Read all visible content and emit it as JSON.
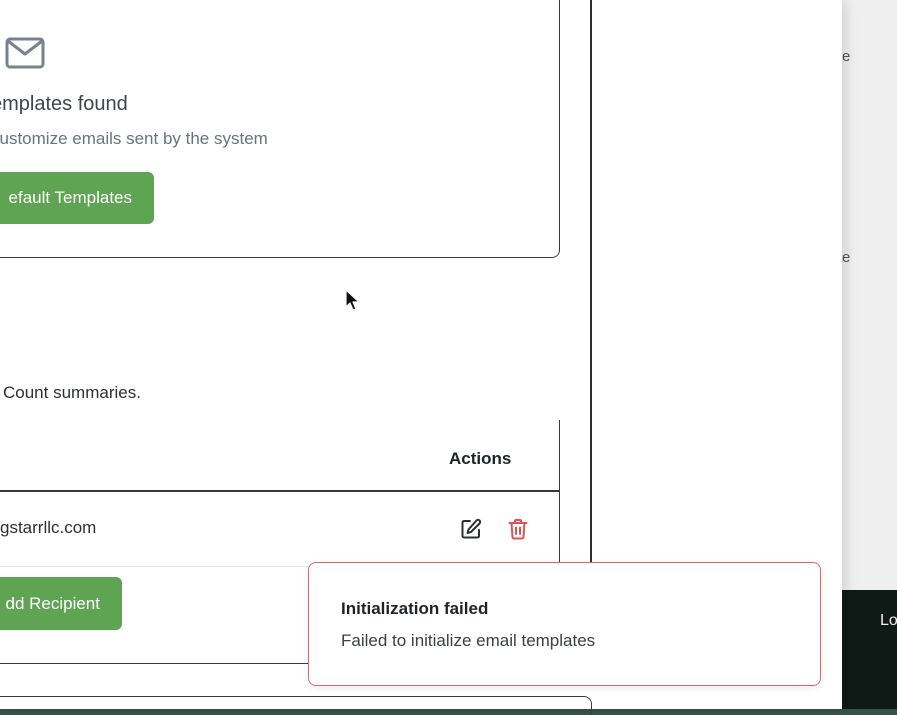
{
  "empty_state": {
    "icon": "mail-icon",
    "title": "emplates found",
    "subtitle": "customize emails sent by the system",
    "button_label": "efault Templates"
  },
  "recipients": {
    "description": "Count summaries.",
    "columns": {
      "actions": "Actions"
    },
    "rows": [
      {
        "email": "gstarrllc.com",
        "actions": [
          "edit-icon",
          "trash-icon"
        ]
      }
    ],
    "add_button_label": "dd Recipient"
  },
  "background": {
    "partial_text_1": "e",
    "partial_text_2": "e",
    "partial_text_3": "Lo"
  },
  "toast": {
    "title": "Initialization failed",
    "message": "Failed to initialize email templates"
  },
  "colors": {
    "primary_button": "#5fa452",
    "error_border": "#e06666",
    "delete_icon": "#e05252"
  }
}
